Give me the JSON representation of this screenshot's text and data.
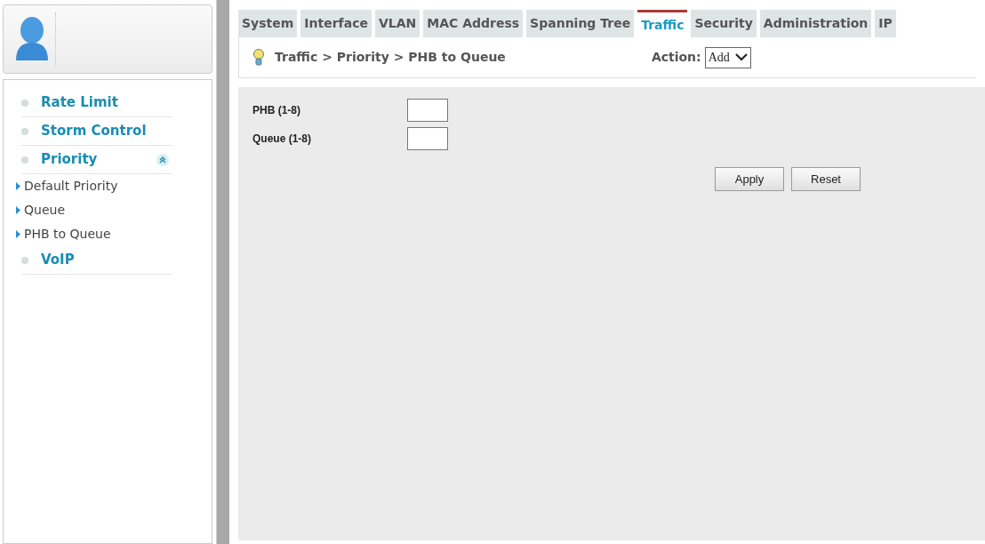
{
  "tabs": [
    {
      "label": "System",
      "selected": false
    },
    {
      "label": "Interface",
      "selected": false
    },
    {
      "label": "VLAN",
      "selected": false
    },
    {
      "label": "MAC Address",
      "selected": false
    },
    {
      "label": "Spanning Tree",
      "selected": false
    },
    {
      "label": "Traffic",
      "selected": true
    },
    {
      "label": "Security",
      "selected": false
    },
    {
      "label": "Administration",
      "selected": false
    },
    {
      "label": "IP",
      "selected": false
    }
  ],
  "sidebar": {
    "items": [
      {
        "label": "Rate Limit",
        "expanded": false
      },
      {
        "label": "Storm Control",
        "expanded": false
      },
      {
        "label": "Priority",
        "expanded": true,
        "children": [
          {
            "label": "Default Priority"
          },
          {
            "label": "Queue"
          },
          {
            "label": "PHB to Queue"
          }
        ]
      },
      {
        "label": "VoIP",
        "expanded": false
      }
    ]
  },
  "breadcrumb": "Traffic > Priority > PHB to Queue",
  "action": {
    "label": "Action:",
    "value": "Add"
  },
  "form": {
    "fields": [
      {
        "label": "PHB (1-8)"
      },
      {
        "label": "Queue (1-8)"
      }
    ],
    "buttons": [
      "Apply",
      "Reset"
    ]
  }
}
